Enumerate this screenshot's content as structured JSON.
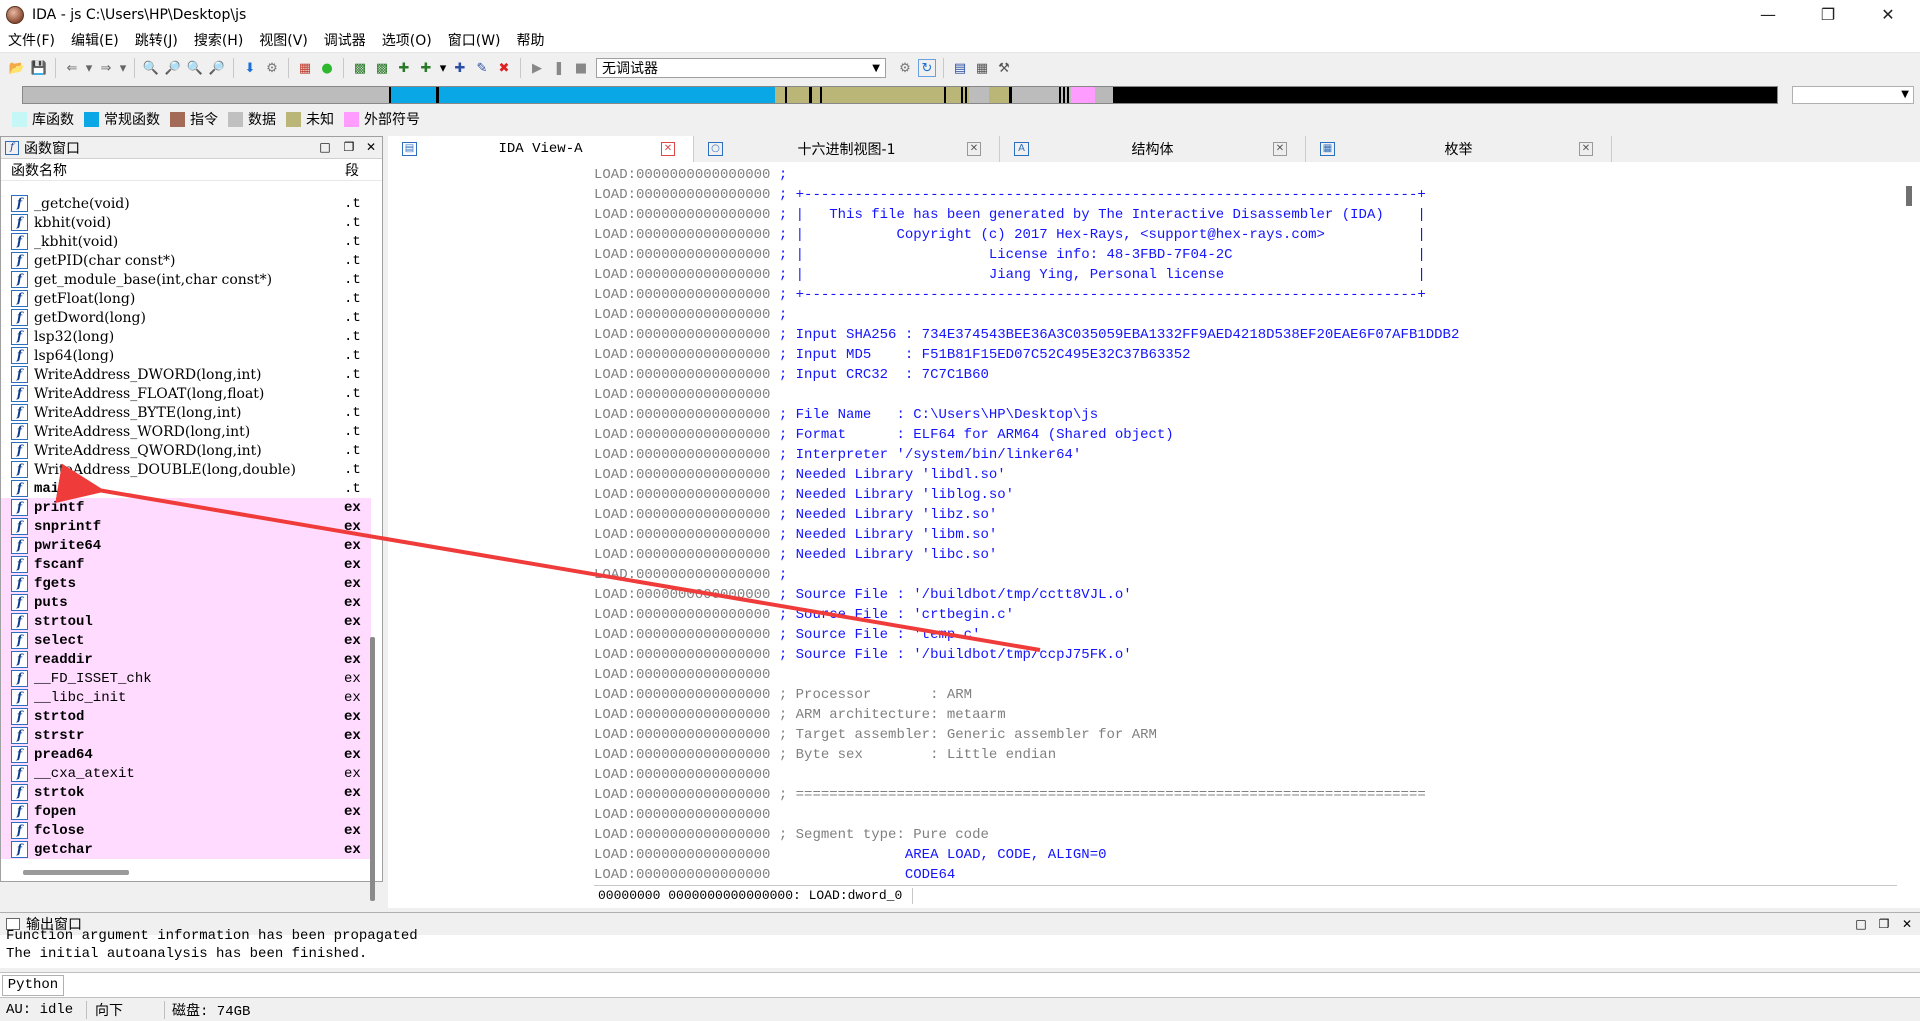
{
  "window": {
    "title": "IDA - js C:\\Users\\HP\\Desktop\\js",
    "minimize_icon": "minimize-icon",
    "maximize_icon": "maximize-icon",
    "close_icon": "close-icon"
  },
  "menu": [
    "文件(F)",
    "编辑(E)",
    "跳转(J)",
    "搜索(H)",
    "视图(V)",
    "调试器",
    "选项(O)",
    "窗口(W)",
    "帮助"
  ],
  "toolbar": {
    "debugger_select": "无调试器"
  },
  "legend": [
    {
      "label": "库函数",
      "color": "#c6f7f7"
    },
    {
      "label": "常规函数",
      "color": "#0aa7e6"
    },
    {
      "label": "指令",
      "color": "#a26a57"
    },
    {
      "label": "数据",
      "color": "#c0c0c0"
    },
    {
      "label": "未知",
      "color": "#b9b677"
    },
    {
      "label": "外部符号",
      "color": "#ff9cff"
    }
  ],
  "functions_panel": {
    "title": "函数窗口",
    "col_name": "函数名称",
    "col_segment": "段",
    "items": [
      {
        "name": "_getche(void)",
        "seg": ".t",
        "ext": false
      },
      {
        "name": "kbhit(void)",
        "seg": ".t",
        "ext": false
      },
      {
        "name": "_kbhit(void)",
        "seg": ".t",
        "ext": false
      },
      {
        "name": "getPID(char const*)",
        "seg": ".t",
        "ext": false
      },
      {
        "name": "get_module_base(int,char const*)",
        "seg": ".t",
        "ext": false
      },
      {
        "name": "getFloat(long)",
        "seg": ".t",
        "ext": false
      },
      {
        "name": "getDword(long)",
        "seg": ".t",
        "ext": false
      },
      {
        "name": "lsp32(long)",
        "seg": ".t",
        "ext": false
      },
      {
        "name": "lsp64(long)",
        "seg": ".t",
        "ext": false
      },
      {
        "name": "WriteAddress_DWORD(long,int)",
        "seg": ".t",
        "ext": false
      },
      {
        "name": "WriteAddress_FLOAT(long,float)",
        "seg": ".t",
        "ext": false
      },
      {
        "name": "WriteAddress_BYTE(long,int)",
        "seg": ".t",
        "ext": false
      },
      {
        "name": "WriteAddress_WORD(long,int)",
        "seg": ".t",
        "ext": false
      },
      {
        "name": "WriteAddress_QWORD(long,int)",
        "seg": ".t",
        "ext": false
      },
      {
        "name": "WriteAddress_DOUBLE(long,double)",
        "seg": ".t",
        "ext": false
      },
      {
        "name": "main",
        "seg": ".t",
        "ext": false,
        "bold": true
      },
      {
        "name": "printf",
        "seg": "ex",
        "ext": true
      },
      {
        "name": "snprintf",
        "seg": "ex",
        "ext": true
      },
      {
        "name": "pwrite64",
        "seg": "ex",
        "ext": true
      },
      {
        "name": "fscanf",
        "seg": "ex",
        "ext": true
      },
      {
        "name": "fgets",
        "seg": "ex",
        "ext": true
      },
      {
        "name": "puts",
        "seg": "ex",
        "ext": true
      },
      {
        "name": "strtoul",
        "seg": "ex",
        "ext": true
      },
      {
        "name": "select",
        "seg": "ex",
        "ext": true
      },
      {
        "name": "readdir",
        "seg": "ex",
        "ext": true
      },
      {
        "name": "__FD_ISSET_chk",
        "seg": "ex",
        "ext": true,
        "light": true
      },
      {
        "name": "__libc_init",
        "seg": "ex",
        "ext": true,
        "light": true
      },
      {
        "name": "strtod",
        "seg": "ex",
        "ext": true
      },
      {
        "name": "strstr",
        "seg": "ex",
        "ext": true
      },
      {
        "name": "pread64",
        "seg": "ex",
        "ext": true
      },
      {
        "name": "__cxa_atexit",
        "seg": "ex",
        "ext": true,
        "light": true
      },
      {
        "name": "strtok",
        "seg": "ex",
        "ext": true
      },
      {
        "name": "fopen",
        "seg": "ex",
        "ext": true
      },
      {
        "name": "fclose",
        "seg": "ex",
        "ext": true
      },
      {
        "name": "getchar",
        "seg": "ex",
        "ext": true
      }
    ]
  },
  "tabs": [
    {
      "label": "IDA View-A",
      "active": true,
      "icon": "ida-view-icon"
    },
    {
      "label": "十六进制视图-1",
      "active": false,
      "icon": "hex-view-icon"
    },
    {
      "label": "结构体",
      "active": false,
      "icon": "structures-icon"
    },
    {
      "label": "枚举",
      "active": false,
      "icon": "enums-icon"
    }
  ],
  "disasm": {
    "addr": "LOAD:0000000000000000",
    "lines": [
      {
        "t": ";",
        "c": "cm"
      },
      {
        "t": "; +-------------------------------------------------------------------------+",
        "c": "cm"
      },
      {
        "t": "; |   This file has been generated by The Interactive Disassembler (IDA)    |",
        "c": "cm"
      },
      {
        "t": "; |           Copyright (c) 2017 Hex-Rays, <support@hex-rays.com>           |",
        "c": "cm"
      },
      {
        "t": "; |                      License info: 48-3FBD-7F04-2C                      |",
        "c": "cm"
      },
      {
        "t": "; |                      Jiang Ying, Personal license                       |",
        "c": "cm"
      },
      {
        "t": "; +-------------------------------------------------------------------------+",
        "c": "cm"
      },
      {
        "t": ";",
        "c": "cm"
      },
      {
        "t": "; Input SHA256 : 734E374543BEE36A3C035059EBA1332FF9AED4218D538EF20EAE6F07AFB1DDB2",
        "c": "cm"
      },
      {
        "t": "; Input MD5    : F51B81F15ED07C52C495E32C37B63352",
        "c": "cm"
      },
      {
        "t": "; Input CRC32  : 7C7C1B60",
        "c": "cm"
      },
      {
        "t": "",
        "c": "cm"
      },
      {
        "t": "; File Name   : C:\\Users\\HP\\Desktop\\js",
        "c": "cm"
      },
      {
        "t": "; Format      : ELF64 for ARM64 (Shared object)",
        "c": "cm"
      },
      {
        "t": "; Interpreter '/system/bin/linker64'",
        "c": "cm"
      },
      {
        "t": "; Needed Library 'libdl.so'",
        "c": "cm"
      },
      {
        "t": "; Needed Library 'liblog.so'",
        "c": "cm"
      },
      {
        "t": "; Needed Library 'libz.so'",
        "c": "cm"
      },
      {
        "t": "; Needed Library 'libm.so'",
        "c": "cm"
      },
      {
        "t": "; Needed Library 'libc.so'",
        "c": "cm"
      },
      {
        "t": ";",
        "c": "cm"
      },
      {
        "t": "; Source File : '/buildbot/tmp/cctt8VJL.o'",
        "c": "cm"
      },
      {
        "t": "; Source File : 'crtbegin.c'",
        "c": "cm"
      },
      {
        "t": "; Source File : 'temp.c'",
        "c": "cm"
      },
      {
        "t": "; Source File : '/buildbot/tmp/ccpJ75FK.o'",
        "c": "cm"
      },
      {
        "t": "",
        "c": "cm"
      },
      {
        "t": "; Processor       : ARM",
        "c": "gc"
      },
      {
        "t": "; ARM architecture: metaarm",
        "c": "gc"
      },
      {
        "t": "; Target assembler: Generic assembler for ARM",
        "c": "gc"
      },
      {
        "t": "; Byte sex        : Little endian",
        "c": "gc"
      },
      {
        "t": "",
        "c": "gc"
      },
      {
        "t": "; ===========================================================================",
        "c": "gc"
      },
      {
        "t": "",
        "c": "gc"
      },
      {
        "t": "; Segment type: Pure code",
        "c": "gc"
      },
      {
        "t": "               AREA LOAD, CODE, ALIGN=0",
        "c": "kw"
      },
      {
        "t": "               CODE64",
        "c": "kw"
      }
    ],
    "status": "00000000 0000000000000000: LOAD:dword_0"
  },
  "output": {
    "title": "输出窗口",
    "lines": [
      "Function argument information has been propagated",
      "The initial autoanalysis has been finished."
    ]
  },
  "python_button": "Python",
  "statusbar": {
    "au": "AU:  idle",
    "dir": "向下",
    "disk": "磁盘: 74GB"
  }
}
